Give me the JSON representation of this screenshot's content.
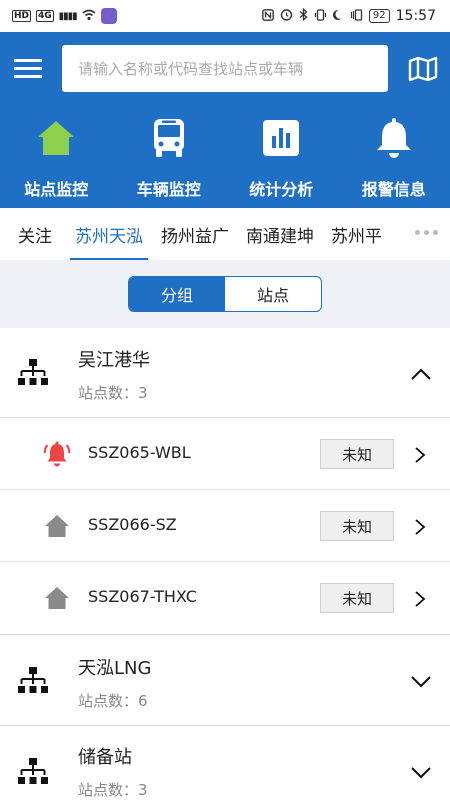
{
  "status_bar": {
    "left_chips": [
      "HD",
      "4G"
    ],
    "signal": "▮▮▮▮",
    "time": "15:57",
    "battery": "92"
  },
  "search": {
    "placeholder": "请输入名称或代码查找站点或车辆"
  },
  "nav": [
    {
      "label": "站点监控",
      "icon": "home-icon",
      "color": "#8fd14f"
    },
    {
      "label": "车辆监控",
      "icon": "bus-icon",
      "color": "#ffffff"
    },
    {
      "label": "统计分析",
      "icon": "bar-chart-icon",
      "color": "#ffffff"
    },
    {
      "label": "报警信息",
      "icon": "bell-icon",
      "color": "#ffffff"
    }
  ],
  "tabs": [
    {
      "label": "关注",
      "active": false
    },
    {
      "label": "苏州天泓",
      "active": true
    },
    {
      "label": "扬州益广",
      "active": false
    },
    {
      "label": "南通建坤",
      "active": false
    },
    {
      "label": "苏州平",
      "active": false
    }
  ],
  "segment": {
    "group_label": "分组",
    "station_label": "站点",
    "selected": "分组"
  },
  "groups": [
    {
      "name": "吴江港华",
      "count_label": "站点数：3",
      "expanded": true,
      "stations": [
        {
          "code": "SSZ065-WBL",
          "status": "未知",
          "icon": "alarm-bell-icon",
          "icon_color": "#ef4444"
        },
        {
          "code": "SSZ066-SZ",
          "status": "未知",
          "icon": "home-icon",
          "icon_color": "#8a8a8a"
        },
        {
          "code": "SSZ067-THXC",
          "status": "未知",
          "icon": "home-icon",
          "icon_color": "#8a8a8a"
        }
      ]
    },
    {
      "name": "天泓LNG",
      "count_label": "站点数：6",
      "expanded": false,
      "stations": []
    },
    {
      "name": "储备站",
      "count_label": "站点数：3",
      "expanded": false,
      "stations": []
    }
  ],
  "colors": {
    "brand": "#1f6fc4",
    "alarm": "#ef4444",
    "home_active": "#8fd14f"
  }
}
